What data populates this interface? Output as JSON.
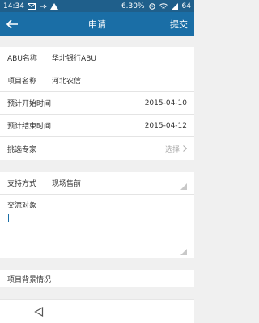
{
  "status_bar": {
    "time": "14:34",
    "battery_percent": "6.30",
    "battery_unit": "%",
    "level_text": "64"
  },
  "app_bar": {
    "title": "申请",
    "submit_label": "提交"
  },
  "form": {
    "abu_name": {
      "label": "ABU名称",
      "value": "华北银行ABU"
    },
    "project_name": {
      "label": "项目名称",
      "value": "河北农信"
    },
    "planned_start": {
      "label": "预计开始时间",
      "value": "2015-04-10"
    },
    "planned_end": {
      "label": "预计结束时间",
      "value": "2015-04-12"
    },
    "choose_expert": {
      "label": "挑选专家",
      "placeholder": "选择"
    },
    "support_method": {
      "label": "支持方式",
      "value": "现场售前"
    },
    "exchange_target": {
      "label": "交流对象"
    },
    "project_background": {
      "label": "项目背景情况"
    }
  },
  "icons": {
    "back": "back-arrow-icon",
    "chevron": "chevron-right-icon",
    "nav_back": "nav-back-triangle-icon"
  },
  "colors": {
    "app_bar": "#1a6ea6",
    "status_bar": "#1f5f8b",
    "caret": "#1a6ea6"
  }
}
